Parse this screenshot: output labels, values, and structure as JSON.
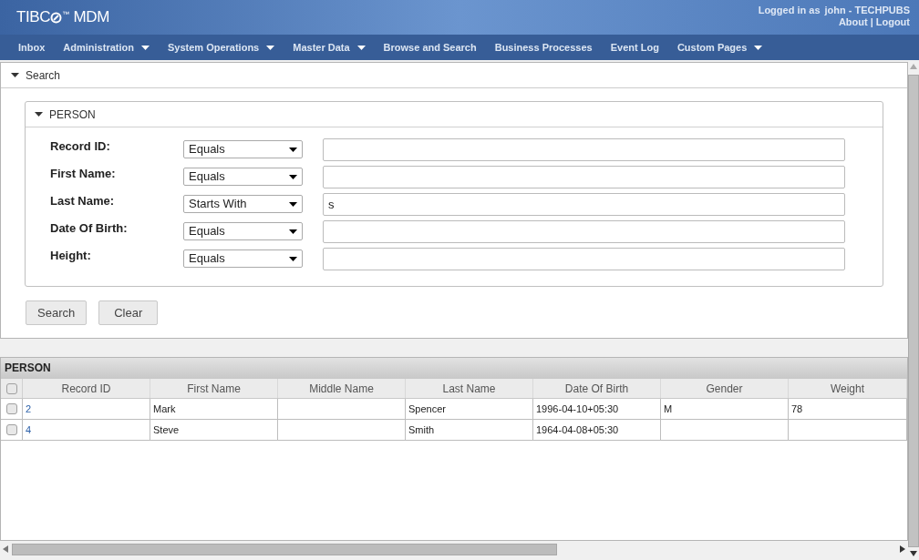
{
  "header": {
    "brand_prefix": "TIBC",
    "brand_tm": "™",
    "product": "MDM",
    "logged_in_label": "Logged in as",
    "user": "john - TECHPUBS",
    "links": [
      "About",
      "Logout"
    ],
    "separator": "|"
  },
  "nav": [
    {
      "label": "Inbox",
      "dropdown": false
    },
    {
      "label": "Administration",
      "dropdown": true
    },
    {
      "label": "System Operations",
      "dropdown": true
    },
    {
      "label": "Master Data",
      "dropdown": true
    },
    {
      "label": "Browse and Search",
      "dropdown": false
    },
    {
      "label": "Business Processes",
      "dropdown": false
    },
    {
      "label": "Event Log",
      "dropdown": false
    },
    {
      "label": "Custom Pages",
      "dropdown": true
    }
  ],
  "search_panel": {
    "title": "Search",
    "expanded": true,
    "entity": {
      "title": "PERSON",
      "expanded": true,
      "fields": [
        {
          "label": "Record ID:",
          "operator": "Equals"
        },
        {
          "label": "First Name:",
          "operator": "Equals"
        },
        {
          "label": "Last Name:",
          "operator": "Starts With",
          "value": "s"
        },
        {
          "label": "Date Of Birth:",
          "operator": "Equals"
        },
        {
          "label": "Height:",
          "operator": "Equals"
        }
      ]
    },
    "buttons": [
      "Search",
      "Clear"
    ]
  },
  "results": {
    "title": "PERSON",
    "all_checked": false,
    "columns": [
      "Record ID",
      "First Name",
      "Middle Name",
      "Last Name",
      "Date Of Birth",
      "Gender",
      "Weight"
    ],
    "rows": [
      {
        "checked": false,
        "cells": [
          "2",
          "Mark",
          null,
          "Spencer",
          "1996-04-10+05:30",
          "M",
          "78"
        ]
      },
      {
        "checked": false,
        "cells": [
          "4",
          "Steve",
          null,
          "Smith",
          "1964-04-08+05:30",
          null,
          null
        ]
      }
    ]
  }
}
